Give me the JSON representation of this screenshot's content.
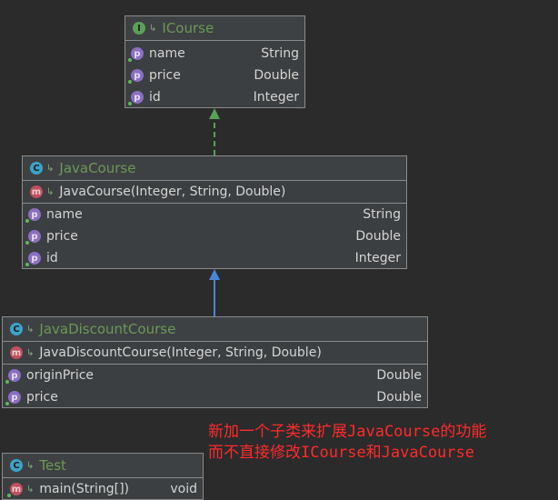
{
  "icourse": {
    "badge": "I",
    "title": "ICourse",
    "rows": [
      {
        "badge": "p",
        "name": "name",
        "type": "String"
      },
      {
        "badge": "p",
        "name": "price",
        "type": "Double"
      },
      {
        "badge": "p",
        "name": "id",
        "type": "Integer"
      }
    ]
  },
  "javacourse": {
    "badge": "C",
    "title": "JavaCourse",
    "method_badge": "m",
    "method": "JavaCourse(Integer, String, Double)",
    "rows": [
      {
        "badge": "p",
        "name": "name",
        "type": "String"
      },
      {
        "badge": "p",
        "name": "price",
        "type": "Double"
      },
      {
        "badge": "p",
        "name": "id",
        "type": "Integer"
      }
    ]
  },
  "javadiscountcourse": {
    "badge": "C",
    "title": "JavaDiscountCourse",
    "method_badge": "m",
    "method": "JavaDiscountCourse(Integer, String, Double)",
    "rows": [
      {
        "badge": "p",
        "name": "originPrice",
        "type": "Double"
      },
      {
        "badge": "p",
        "name": "price",
        "type": "Double"
      }
    ]
  },
  "test": {
    "badge": "C",
    "title": "Test",
    "method_badge": "m",
    "method": "main(String[])",
    "method_type": "void"
  },
  "note": {
    "line1": "新加一个子类来扩展JavaCourse的功能",
    "line2": "而不直接修改ICourse和JavaCourse"
  },
  "colors": {
    "background": "#2b2b2b",
    "implements_arrow": "#5aa05a",
    "extends_arrow": "#4a86d8",
    "note_text": "#ff2a2a"
  }
}
